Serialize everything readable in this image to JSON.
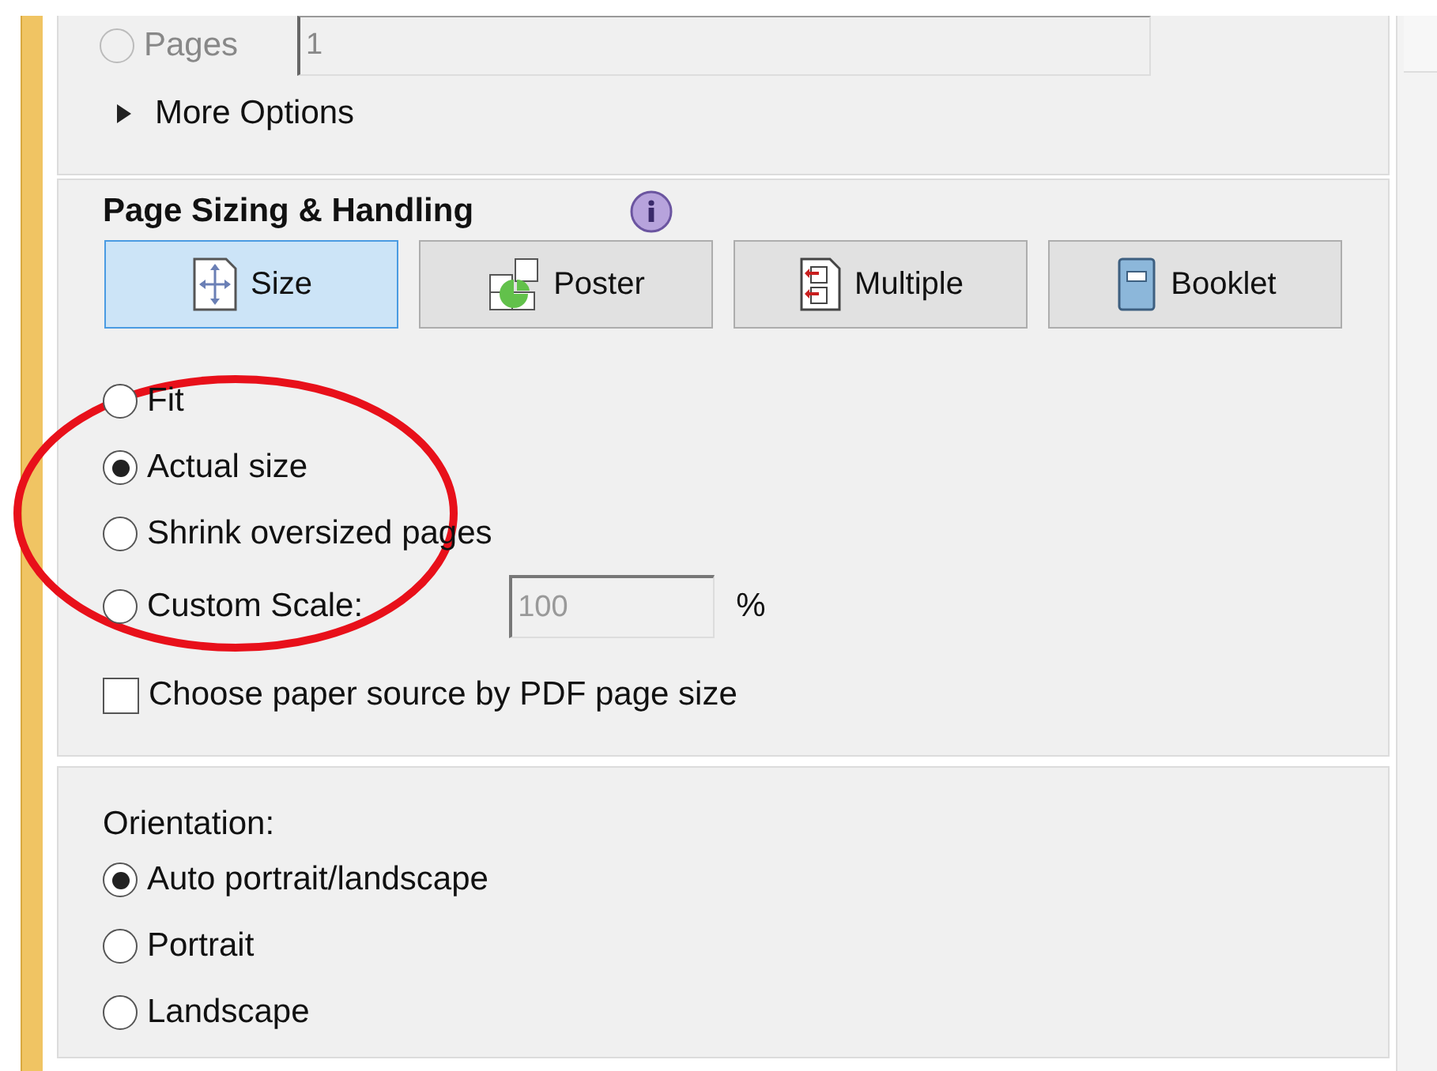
{
  "print_range": {
    "pages": {
      "label": "Pages",
      "selected": false,
      "disabled": true,
      "value": "1"
    },
    "more_options": {
      "label": "More Options",
      "expanded": false
    }
  },
  "page_sizing": {
    "title": "Page Sizing & Handling",
    "modes": [
      {
        "label": "Size",
        "kind": "size",
        "selected": true
      },
      {
        "label": "Poster",
        "kind": "poster",
        "selected": false
      },
      {
        "label": "Multiple",
        "kind": "multiple",
        "selected": false
      },
      {
        "label": "Booklet",
        "kind": "booklet",
        "selected": false
      }
    ],
    "scaling": [
      {
        "kind": "plain",
        "label": "Fit",
        "selected": false
      },
      {
        "kind": "plain",
        "label": "Actual size",
        "selected": true
      },
      {
        "kind": "plain",
        "label": "Shrink oversized pages",
        "selected": false
      },
      {
        "kind": "scale",
        "label": "Custom Scale:",
        "selected": false,
        "value": "100",
        "unit": "%"
      }
    ],
    "paper_source": {
      "label": "Choose paper source by PDF page size",
      "checked": false
    }
  },
  "orientation": {
    "label": "Orientation:",
    "options": [
      {
        "label": "Auto portrait/landscape",
        "selected": true
      },
      {
        "label": "Portrait",
        "selected": false
      },
      {
        "label": "Landscape",
        "selected": false
      }
    ]
  }
}
